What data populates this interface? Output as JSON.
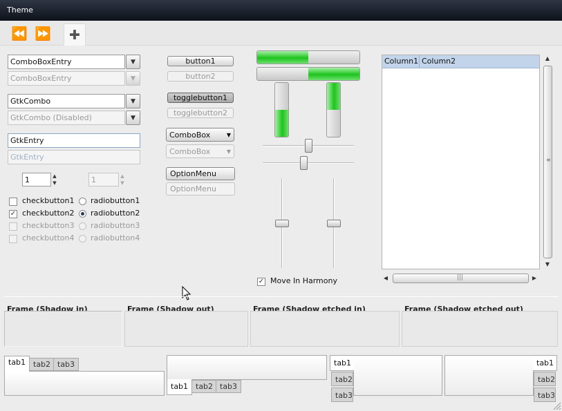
{
  "window": {
    "title": "Theme"
  },
  "toolbar": {
    "back_icon": "⏪",
    "forward_icon": "⏩",
    "add_icon": "✚"
  },
  "entries": {
    "combo_entry": "ComboBoxEntry",
    "combo_entry_disabled": "ComboBoxEntry",
    "gtk_combo": "GtkCombo",
    "gtk_combo_disabled": "GtkCombo (Disabled)",
    "gtk_entry": "GtkEntry",
    "gtk_entry_disabled": "GtkEntry",
    "spin1": "1",
    "spin2": "1"
  },
  "checks": {
    "check1": "checkbutton1",
    "check2": "checkbutton2",
    "check3": "checkbutton3",
    "check4": "checkbutton4",
    "radio1": "radiobutton1",
    "radio2": "radiobutton2",
    "radio3": "radiobutton3",
    "radio4": "radiobutton4"
  },
  "buttons": {
    "button1": "button1",
    "button2": "button2",
    "toggle1": "togglebutton1",
    "toggle2": "togglebutton2",
    "combobox": "ComboBox",
    "combobox_disabled": "ComboBox",
    "optionmenu": "OptionMenu",
    "optionmenu_disabled": "OptionMenu"
  },
  "progress": {
    "h1_fraction": 0.5,
    "h2_fraction": 0.5,
    "v1_fraction": 0.5,
    "v2_fraction": 0.5,
    "color": "#1dc41d"
  },
  "sliders": {
    "h1_value": 0.5,
    "h2_value": 0.45,
    "v1_value": 0.5,
    "v2_value": 0.5
  },
  "move_in_harmony": "Move In Harmony",
  "tree": {
    "columns": [
      "Column1",
      "Column2"
    ],
    "header_color": "#c2d4ea"
  },
  "frames": [
    "Frame (Shadow in)",
    "Frame (Shadow out)",
    "Frame (Shadow etched in)",
    "Frame (Shadow etched out)"
  ],
  "tabs": [
    "tab1",
    "tab2",
    "tab3"
  ]
}
